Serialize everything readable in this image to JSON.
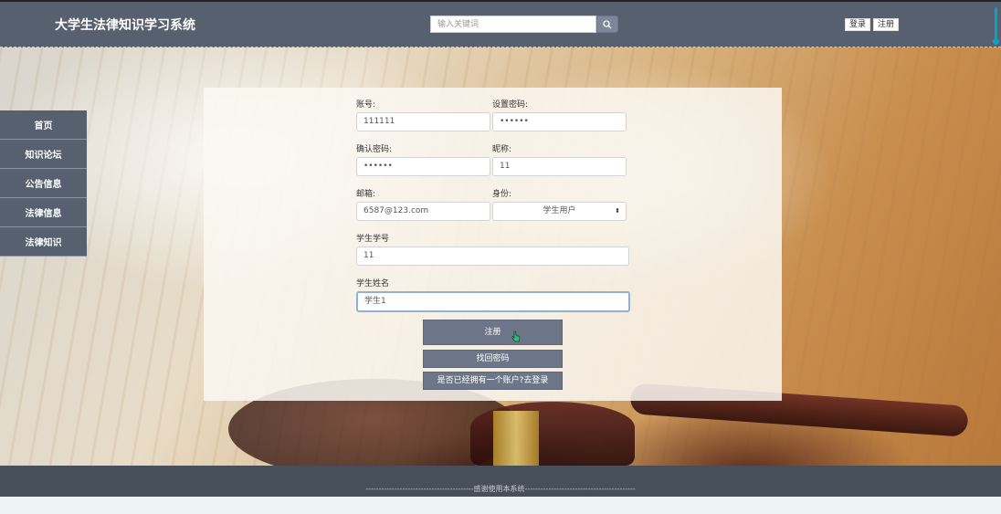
{
  "header": {
    "title": "大学生法律知识学习系统",
    "search_placeholder": "输入关键词",
    "login_label": "登录",
    "register_label": "注册"
  },
  "sidebar": {
    "items": [
      {
        "label": "首页"
      },
      {
        "label": "知识论坛"
      },
      {
        "label": "公告信息"
      },
      {
        "label": "法律信息"
      },
      {
        "label": "法律知识"
      }
    ]
  },
  "form": {
    "account_label": "账号:",
    "account_value": "111111",
    "password_label": "设置密码:",
    "password_value": "••••••",
    "confirm_label": "确认密码:",
    "confirm_value": "••••••",
    "nickname_label": "昵称:",
    "nickname_value": "11",
    "email_label": "邮箱:",
    "email_value": "6587@123.com",
    "role_label": "身份:",
    "role_value": "学生用户",
    "student_id_label": "学生学号",
    "student_id_value": "11",
    "student_name_label": "学生姓名",
    "student_name_value": "学生1",
    "register_button": "注册",
    "forgot_button": "找回密码",
    "login_link_button": "是否已经拥有一个账户?去登录"
  },
  "footer": {
    "text": "-----------------------------------------感谢使用本系统------------------------------------------"
  },
  "colors": {
    "header_bg": "#56606f",
    "footer_bg": "#474f5b",
    "button_bg": "#6d7689"
  }
}
